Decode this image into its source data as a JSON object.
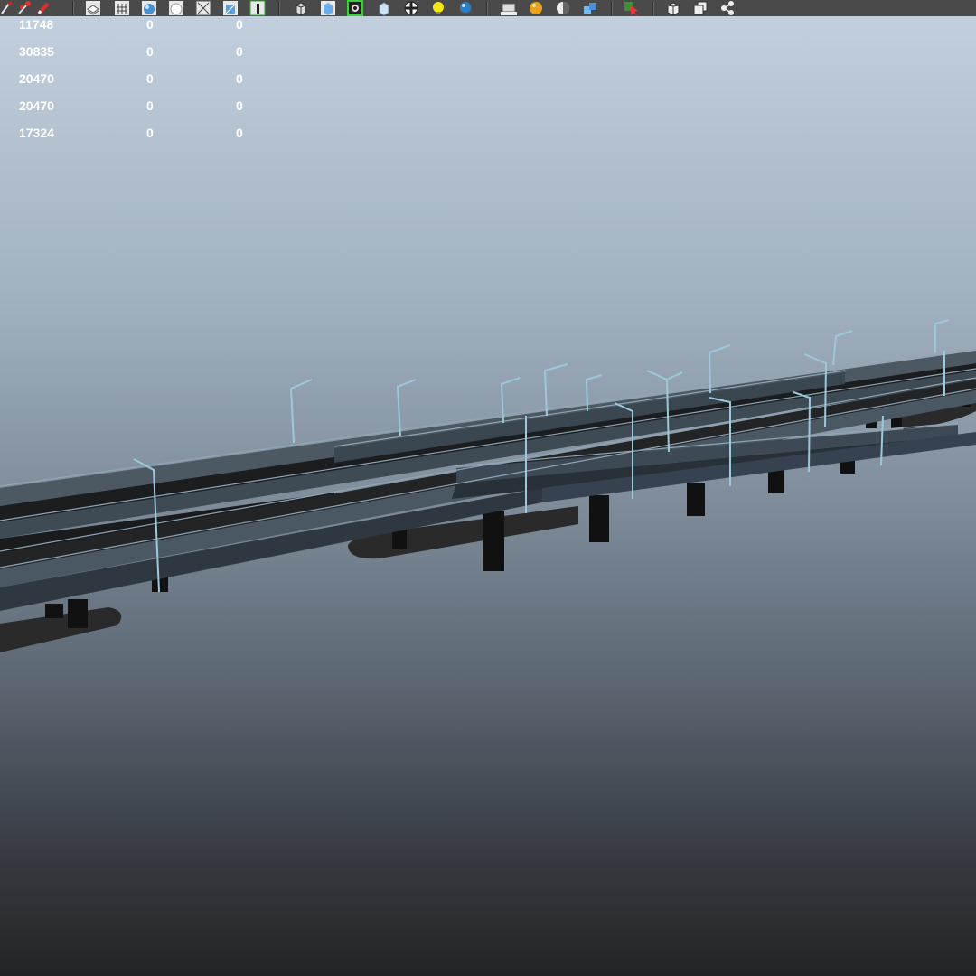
{
  "toolbar": {
    "icons": [
      {
        "name": "paint-effects-icon"
      },
      {
        "name": "brush-icon"
      },
      {
        "name": "separator"
      },
      {
        "name": "layers-icon"
      },
      {
        "name": "grid-icon"
      },
      {
        "name": "smooth-shade-icon"
      },
      {
        "name": "wireframe-sphere-icon"
      },
      {
        "name": "xray-icon"
      },
      {
        "name": "texture-icon"
      },
      {
        "name": "resolution-gate-icon"
      },
      {
        "name": "separator"
      },
      {
        "name": "isolate-select-icon"
      },
      {
        "name": "cube-icon"
      },
      {
        "name": "active-render-icon"
      },
      {
        "name": "bounding-box-icon"
      },
      {
        "name": "checker-icon"
      },
      {
        "name": "light-bulb-icon"
      },
      {
        "name": "shaded-sphere-icon"
      },
      {
        "name": "separator"
      },
      {
        "name": "camera-icon"
      },
      {
        "name": "orange-sphere-icon"
      },
      {
        "name": "half-sphere-icon"
      },
      {
        "name": "blue-cubes-icon"
      },
      {
        "name": "separator"
      },
      {
        "name": "select-cursor-icon"
      },
      {
        "name": "separator"
      },
      {
        "name": "box-icon"
      },
      {
        "name": "duplicate-icon"
      },
      {
        "name": "share-icon"
      }
    ]
  },
  "hud": {
    "rows": [
      {
        "c1": "11748",
        "c2": "0",
        "c3": "0"
      },
      {
        "c1": "30835",
        "c2": "0",
        "c3": "0"
      },
      {
        "c1": "20470",
        "c2": "0",
        "c3": "0"
      },
      {
        "c1": "20470",
        "c2": "0",
        "c3": "0"
      },
      {
        "c1": "17324",
        "c2": "0",
        "c3": "0"
      }
    ]
  },
  "colors": {
    "toolbar_bg": "#4a4a4a",
    "viewport_top": "#c2cfdc",
    "viewport_bottom": "#232426",
    "hud_text": "#ffffff",
    "road_deck": "#3a4650",
    "lamp_post": "#9cc8dc"
  }
}
